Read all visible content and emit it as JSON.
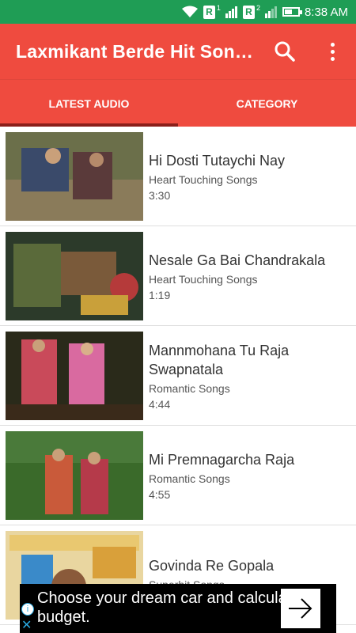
{
  "statusbar": {
    "time": "8:38 AM",
    "sim1": "R",
    "sim1_sup": "1",
    "sim2": "R",
    "sim2_sup": "2"
  },
  "appbar": {
    "title": "Laxmikant Berde Hit Son…"
  },
  "tabs": [
    {
      "label": "LATEST AUDIO",
      "active": true
    },
    {
      "label": "CATEGORY",
      "active": false
    }
  ],
  "songs": [
    {
      "title": "Hi Dosti Tutaychi Nay",
      "category": "Heart Touching Songs",
      "duration": "3:30"
    },
    {
      "title": "Nesale Ga Bai Chandrakala",
      "category": "Heart Touching Songs",
      "duration": "1:19"
    },
    {
      "title": "Mannmohana Tu Raja Swapnatala",
      "category": "Romantic Songs",
      "duration": "4:44"
    },
    {
      "title": "Mi Premnagarcha Raja",
      "category": "Romantic Songs",
      "duration": "4:55"
    },
    {
      "title": "Govinda Re Gopala",
      "category": "Superhit Songs",
      "duration": ""
    }
  ],
  "ad": {
    "text": "Choose your dream car and calculate budget."
  },
  "colors": {
    "primary": "#ef4b3f",
    "statusbar": "#1f9d55",
    "tab_indicator": "#8a1f1a"
  }
}
